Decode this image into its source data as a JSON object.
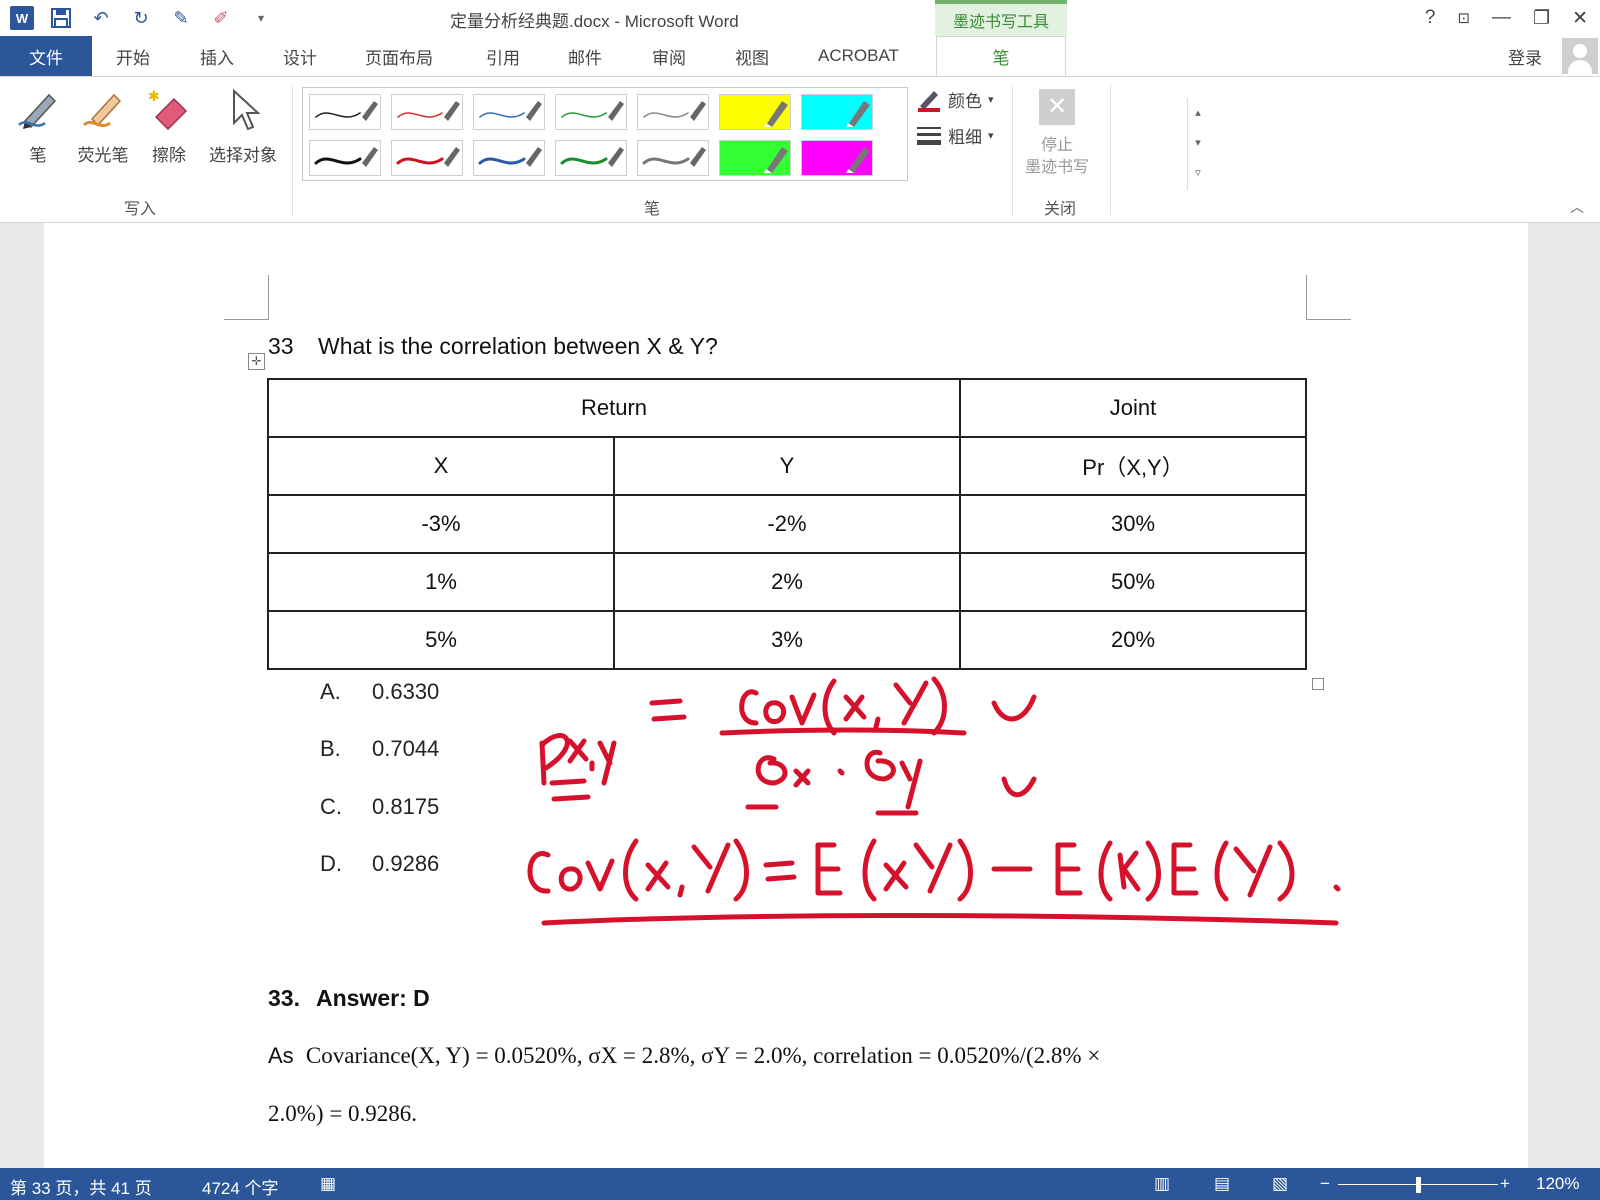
{
  "window": {
    "doc_title": "定量分析经典题.docx - Microsoft Word",
    "contextual_tab": "墨迹书写工具",
    "help": "?",
    "min": "—",
    "restore": "❐",
    "close": "✕"
  },
  "tabs": {
    "file": "文件",
    "items": [
      "开始",
      "插入",
      "设计",
      "页面布局",
      "引用",
      "邮件",
      "审阅",
      "视图",
      "ACROBAT"
    ],
    "active": "笔",
    "login": "登录"
  },
  "ribbon": {
    "write": {
      "pen": "笔",
      "highlighter": "荧光笔",
      "eraser": "擦除",
      "select": "选择对象",
      "label": "写入"
    },
    "pens": {
      "label": "笔",
      "colors": [
        "#222222",
        "#d03030",
        "#3a6fb0",
        "#2a9a3a",
        "#888888",
        "#ffff00",
        "#00ffff",
        "#111111",
        "#d01020",
        "#2a5aa0",
        "#1a8a2a",
        "#777777",
        "#33ff33",
        "#ff00ff"
      ]
    },
    "color": "颜色",
    "thickness": "粗细",
    "stop_line1": "停止",
    "stop_line2": "墨迹书写",
    "close_label": "关闭"
  },
  "document": {
    "question_number": "33",
    "question_text": "What is the correlation between X & Y?",
    "table": {
      "header_return": "Return",
      "header_joint": "Joint",
      "header_x": "X",
      "header_y": "Y",
      "header_pr": "Pr（X,Y）",
      "rows": [
        [
          "-3%",
          "-2%",
          "30%"
        ],
        [
          "1%",
          "2%",
          "50%"
        ],
        [
          "5%",
          "3%",
          "20%"
        ]
      ]
    },
    "options": [
      {
        "letter": "A.",
        "value": "0.6330"
      },
      {
        "letter": "B.",
        "value": "0.7044"
      },
      {
        "letter": "C.",
        "value": "0.8175"
      },
      {
        "letter": "D.",
        "value": "0.9286"
      }
    ],
    "answer_number": "33.",
    "answer_text": "Answer: D",
    "explanation_lead": "As",
    "explanation_line1": "Covariance(X, Y) =  0.0520%, σX = 2.8%, σY  =  2.0%,  correlation  = 0.0520%/(2.8% ×",
    "explanation_line2": "2.0%)  =  0.9286."
  },
  "status": {
    "page": "第 33 页，共 41 页",
    "words": "4724 个字",
    "zoom": "120%",
    "minus": "−",
    "plus": "+"
  }
}
